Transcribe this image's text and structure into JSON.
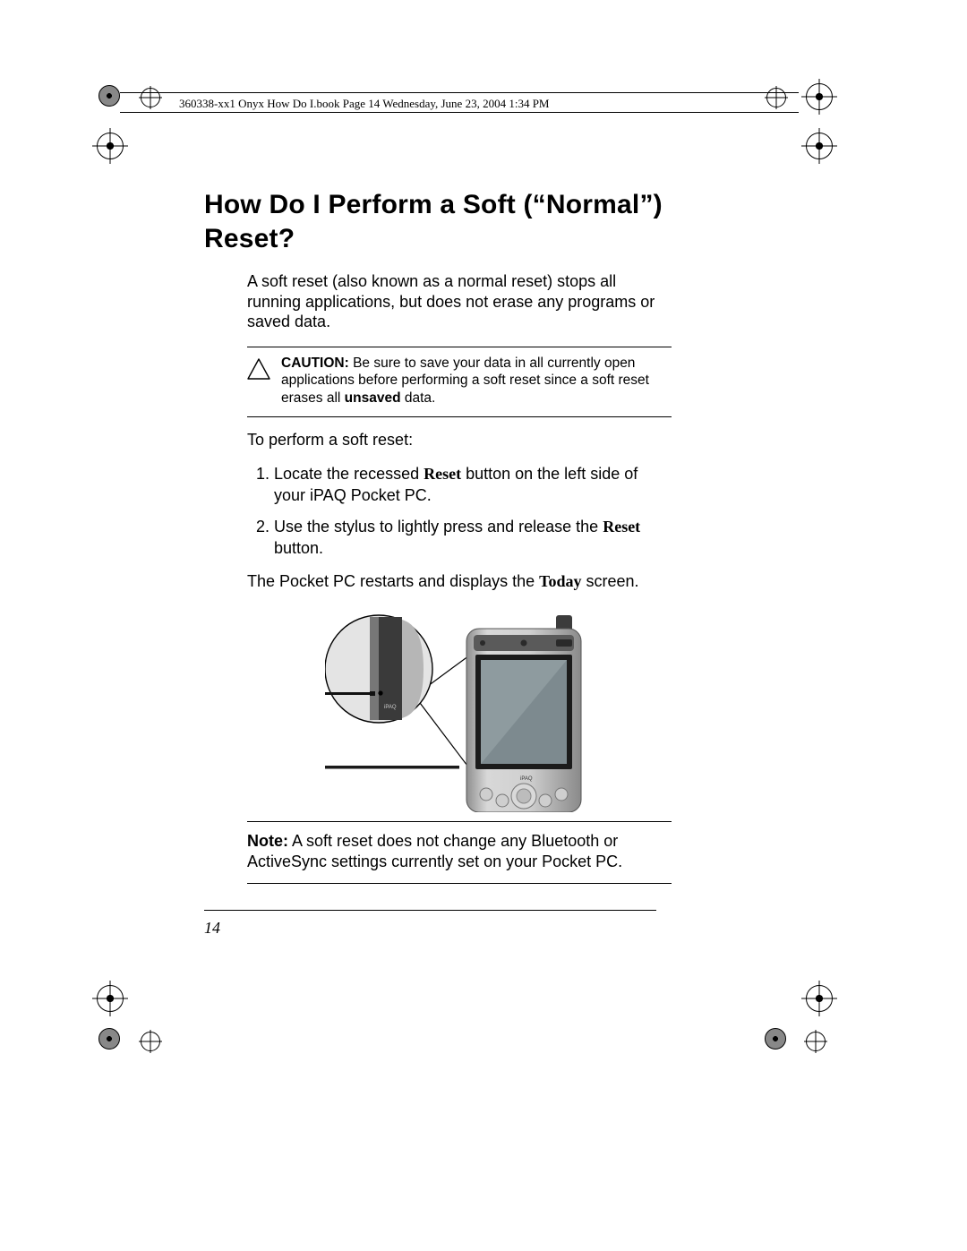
{
  "header_meta": "360338-xx1 Onyx How Do I.book  Page 14  Wednesday, June 23, 2004  1:34 PM",
  "title": "How Do I Perform a Soft (“Normal”) Reset?",
  "intro": "A soft reset (also known as a normal reset) stops all running applications, but does not erase any programs or saved data.",
  "caution": {
    "label": "CAUTION:",
    "text_before_bold": " Be sure to save your data in all currently open applications before performing a soft reset since a soft reset erases all ",
    "bold_word": "unsaved",
    "text_after_bold": " data."
  },
  "lead": "To perform a soft reset:",
  "steps": [
    {
      "pre": "Locate the recessed ",
      "kw": "Reset",
      "post": " button on the left side of your iPAQ Pocket PC."
    },
    {
      "pre": "Use the stylus to lightly press and release the ",
      "kw": "Reset",
      "post": " button."
    }
  ],
  "result": {
    "pre": "The Pocket PC restarts and displays the ",
    "kw": "Today",
    "post": " screen."
  },
  "note": {
    "label": "Note:",
    "text": " A soft reset does not change any Bluetooth or ActiveSync settings currently set on your Pocket PC."
  },
  "page_number": "14",
  "figure_alt": "iPAQ Pocket PC with callout showing stylus pressing recessed Reset button"
}
